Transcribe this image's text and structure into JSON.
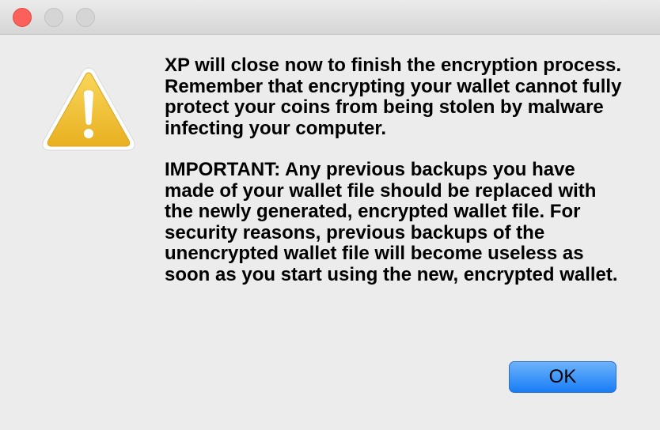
{
  "window": {
    "controls": [
      "close",
      "minimize",
      "maximize"
    ]
  },
  "dialog": {
    "icon": "warning-icon",
    "message_line_1": "XP will close now to finish the encryption process. Remember that encrypting your wallet cannot fully protect your coins from being stolen by malware infecting your computer.",
    "message_line_2": "IMPORTANT: Any previous backups you have made of your wallet file should be replaced with the newly generated, encrypted wallet file. For security reasons, previous backups of the unencrypted wallet file will become useless as soon as you start using the new, encrypted wallet.",
    "ok_label": "OK"
  },
  "colors": {
    "close": "#fc605b",
    "inactive_control": "#d5d5d5",
    "button_blue": "#197df6",
    "warning_yellow": "#f2c12e"
  }
}
